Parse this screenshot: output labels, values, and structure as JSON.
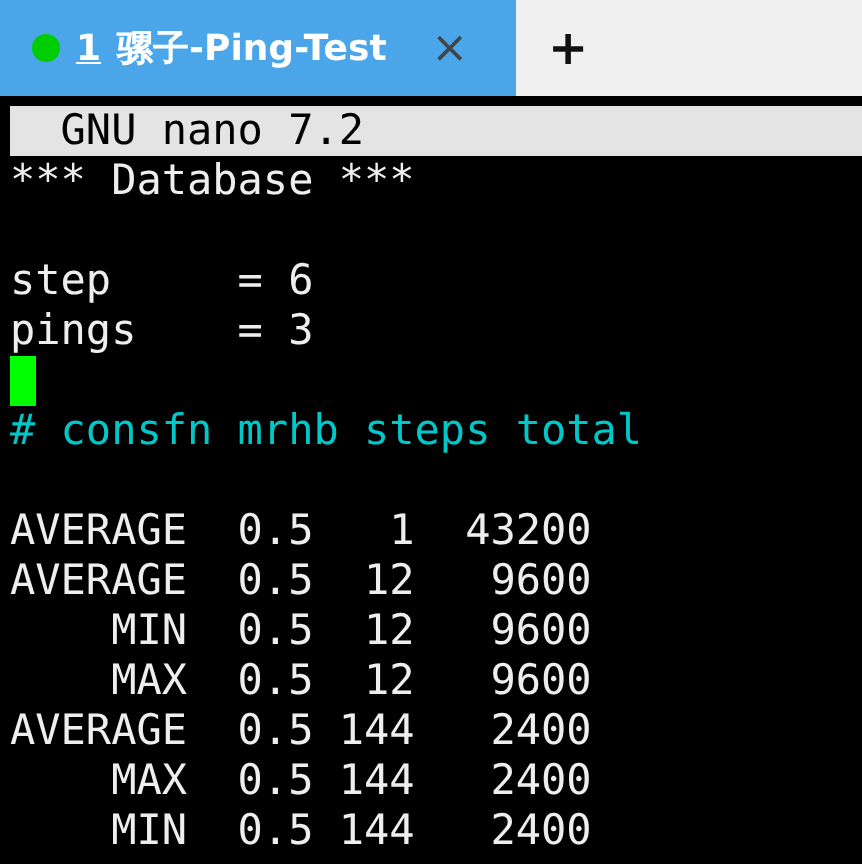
{
  "tabs": [
    {
      "number": "1",
      "title": "骡子-Ping-Test",
      "selected": true,
      "connected": true,
      "close": "×"
    }
  ],
  "new_tab": "+",
  "editor": {
    "title": "  GNU nano 7.2",
    "lines": [
      {
        "kind": "text",
        "text": "*** Database ***"
      },
      {
        "kind": "blank"
      },
      {
        "kind": "text",
        "text": "step     = 6"
      },
      {
        "kind": "text",
        "text": "pings    = 3"
      },
      {
        "kind": "cursor"
      },
      {
        "kind": "comment",
        "text": "# consfn mrhb steps total"
      },
      {
        "kind": "blank"
      },
      {
        "kind": "text",
        "text": "AVERAGE  0.5   1  43200"
      },
      {
        "kind": "text",
        "text": "AVERAGE  0.5  12   9600"
      },
      {
        "kind": "text",
        "text": "    MIN  0.5  12   9600"
      },
      {
        "kind": "text",
        "text": "    MAX  0.5  12   9600"
      },
      {
        "kind": "text",
        "text": "AVERAGE  0.5 144   2400"
      },
      {
        "kind": "text",
        "text": "    MAX  0.5 144   2400"
      },
      {
        "kind": "text",
        "text": "    MIN  0.5 144   2400"
      }
    ]
  }
}
